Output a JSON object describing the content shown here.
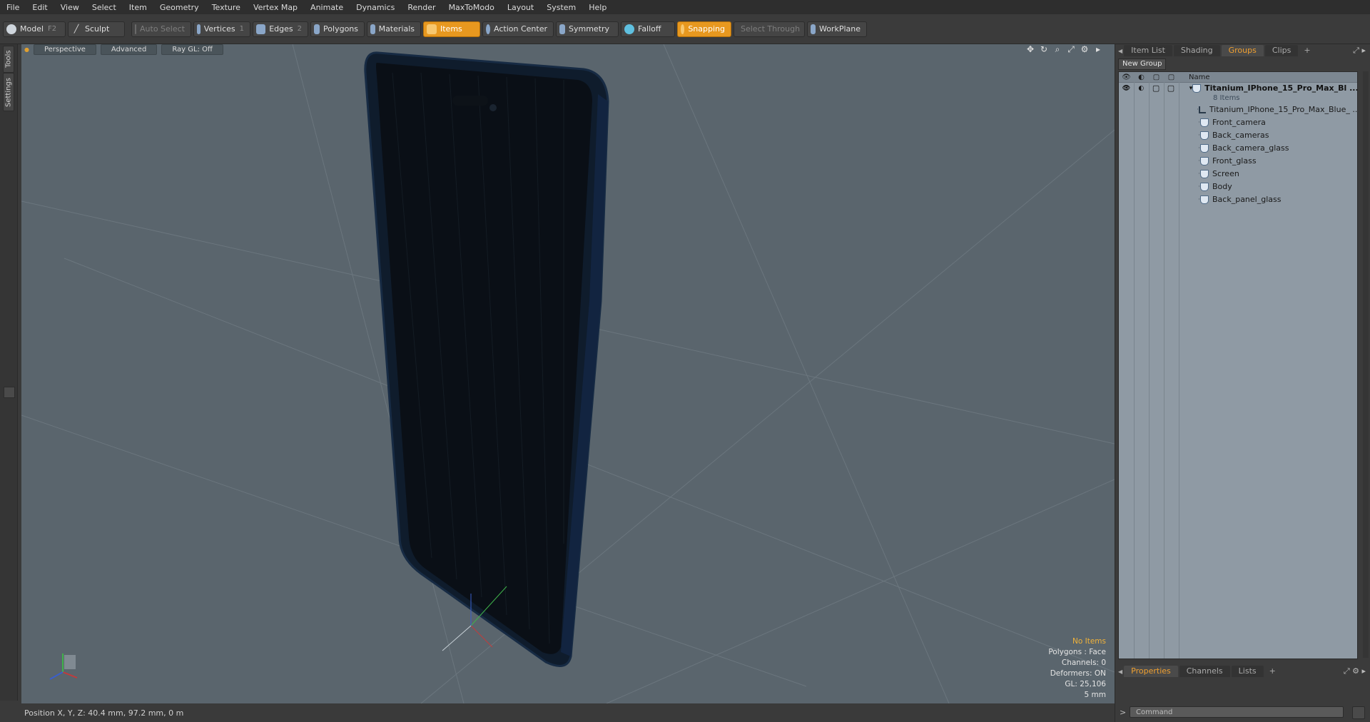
{
  "menu": [
    "File",
    "Edit",
    "View",
    "Select",
    "Item",
    "Geometry",
    "Texture",
    "Vertex Map",
    "Animate",
    "Dynamics",
    "Render",
    "MaxToModo",
    "Layout",
    "System",
    "Help"
  ],
  "toolbar": {
    "model": "Model",
    "model_key": "F2",
    "sculpt": "Sculpt",
    "auto_select": "Auto Select",
    "vertices": "Vertices",
    "vertices_key": "1",
    "edges": "Edges",
    "edges_key": "2",
    "polygons": "Polygons",
    "materials": "Materials",
    "items": "Items",
    "action_center": "Action Center",
    "symmetry": "Symmetry",
    "falloff": "Falloff",
    "snapping": "Snapping",
    "select_through": "Select Through",
    "workplane": "WorkPlane"
  },
  "left_tabs": [
    "Tools",
    "Settings"
  ],
  "viewport": {
    "view": "Perspective",
    "shading": "Advanced",
    "raygl": "Ray GL: Off",
    "info": {
      "selection": "No Items",
      "polygons": "Polygons : Face",
      "channels": "Channels: 0",
      "deformers": "Deformers: ON",
      "gl": "GL: 25,106",
      "scale": "5 mm"
    }
  },
  "status": {
    "position": "Position X, Y, Z:   40.4 mm, 97.2 mm, 0 m"
  },
  "panel": {
    "tabs": [
      "Item List",
      "Shading",
      "Groups",
      "Clips",
      "+"
    ],
    "active_tab": "Groups",
    "new_group": "New Group",
    "name_col": "Name",
    "group_name": "Titanium_IPhone_15_Pro_Max_Bl ...",
    "group_count": "8 Items",
    "children": [
      "Titanium_IPhone_15_Pro_Max_Blue_ ...",
      "Front_camera",
      "Back_cameras",
      "Back_camera_glass",
      "Front_glass",
      "Screen",
      "Body",
      "Back_panel_glass"
    ],
    "bottom_tabs": [
      "Properties",
      "Channels",
      "Lists",
      "+"
    ],
    "command_placeholder": "Command"
  },
  "colors": {
    "accent": "#e7981f",
    "viewport_bg": "#5a656d",
    "tree_bg": "#8f9aa4",
    "phone_body": "#0e1a2a"
  }
}
